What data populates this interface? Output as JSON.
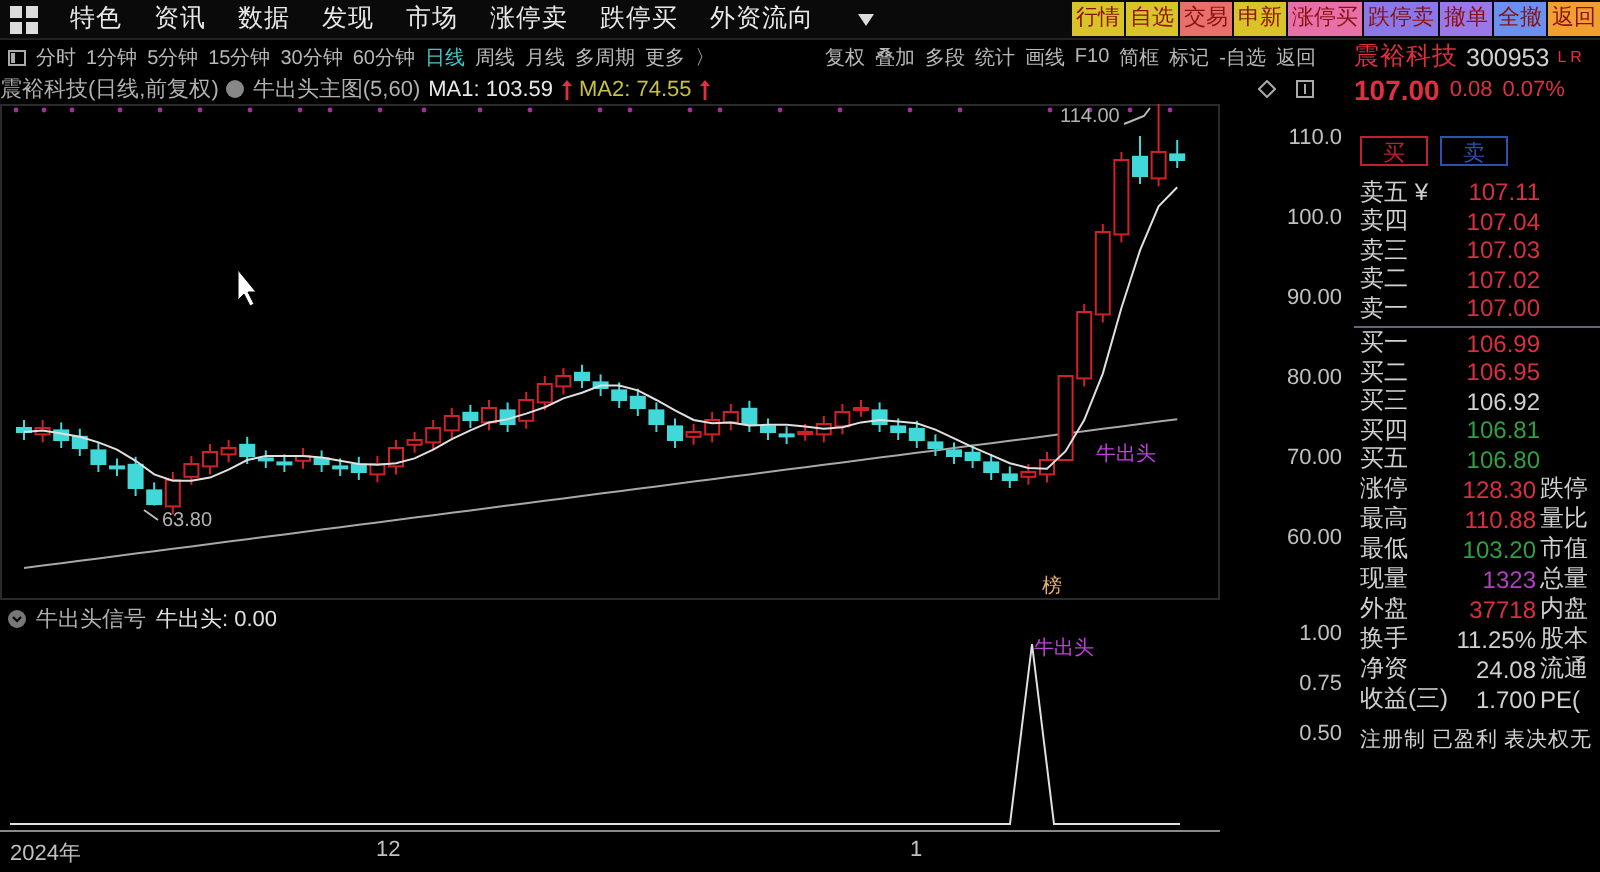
{
  "menu": {
    "items": [
      "特色",
      "资讯",
      "数据",
      "发现",
      "市场",
      "涨停卖",
      "跌停买",
      "外资流向"
    ]
  },
  "quick_buttons": [
    {
      "label": "行情",
      "color": "#d8c428"
    },
    {
      "label": "自选",
      "color": "#d8c428"
    },
    {
      "label": "交易",
      "color": "#e8706a"
    },
    {
      "label": "申新",
      "color": "#d8c428"
    },
    {
      "label": "涨停买",
      "color": "#e870a8"
    },
    {
      "label": "跌停卖",
      "color": "#8a78e8"
    },
    {
      "label": "撤单",
      "color": "#9a78e8"
    },
    {
      "label": "全撤",
      "color": "#6a90f0"
    },
    {
      "label": "返回",
      "color": "#f0a030"
    }
  ],
  "periods": [
    {
      "label": "分时",
      "selected": false
    },
    {
      "label": "1分钟",
      "selected": false
    },
    {
      "label": "5分钟",
      "selected": false
    },
    {
      "label": "15分钟",
      "selected": false
    },
    {
      "label": "30分钟",
      "selected": false
    },
    {
      "label": "60分钟",
      "selected": false
    },
    {
      "label": "日线",
      "selected": true
    },
    {
      "label": "周线",
      "selected": false
    },
    {
      "label": "月线",
      "selected": false
    },
    {
      "label": "多周期",
      "selected": false
    },
    {
      "label": "更多",
      "selected": false
    }
  ],
  "more_arrow": "〉",
  "tools": [
    "复权",
    "叠加",
    "多段",
    "统计",
    "画线",
    "F10",
    "简框",
    "标记",
    "-自选",
    "返回"
  ],
  "legend": {
    "title": "震裕科技(日线,前复权)",
    "indicator": "牛出头主图(5,60)",
    "ma1": "MA1: 103.59",
    "ma2": "MA2: 74.55"
  },
  "chart": {
    "high_label": "114.00",
    "low_label": "63.80",
    "signal_label": "牛出头",
    "rank_badge": "榜",
    "chart_data": {
      "type": "candlestick",
      "ylim": [
        52,
        114
      ],
      "ohlc": [
        [
          73.5,
          74.5,
          72,
          73
        ],
        [
          72.7,
          74.5,
          71.7,
          73.5
        ],
        [
          73.2,
          74.2,
          71,
          72
        ],
        [
          72.4,
          73.4,
          70,
          71
        ],
        [
          70.7,
          71.7,
          68,
          69
        ],
        [
          68.7,
          69.7,
          67.5,
          68.5
        ],
        [
          68.9,
          69.9,
          65,
          66
        ],
        [
          65.7,
          66.7,
          63.8,
          64
        ],
        [
          63.7,
          68,
          62.7,
          67
        ],
        [
          67.4,
          70,
          66.4,
          69
        ],
        [
          68.7,
          71.5,
          67.7,
          70.5
        ],
        [
          70.2,
          72,
          69.2,
          71
        ],
        [
          71.4,
          72.4,
          69,
          70
        ],
        [
          69.7,
          70.7,
          68.5,
          69.5
        ],
        [
          69.2,
          70.2,
          68,
          69
        ],
        [
          69.4,
          71,
          68.4,
          70
        ],
        [
          69.7,
          70.7,
          68,
          69
        ],
        [
          68.7,
          69.7,
          67.5,
          68.5
        ],
        [
          68.9,
          69.9,
          67,
          68
        ],
        [
          67.7,
          70,
          66.7,
          69
        ],
        [
          68.7,
          72,
          67.7,
          71
        ],
        [
          71.4,
          73,
          70.4,
          72
        ],
        [
          71.7,
          74.5,
          70.7,
          73.5
        ],
        [
          73.2,
          76,
          72.2,
          75
        ],
        [
          75.4,
          76.4,
          73.5,
          74.5
        ],
        [
          74.2,
          77,
          73.2,
          76
        ],
        [
          75.7,
          76.7,
          73,
          74
        ],
        [
          74.4,
          78,
          73.4,
          77
        ],
        [
          76.7,
          80,
          75.7,
          79
        ],
        [
          78.7,
          81,
          77.7,
          80
        ],
        [
          80.4,
          81.4,
          78.5,
          79.5
        ],
        [
          79.2,
          80.2,
          77.5,
          78.5
        ],
        [
          78.2,
          79.2,
          76,
          77
        ],
        [
          77.4,
          78.4,
          75,
          76
        ],
        [
          75.7,
          76.7,
          73,
          74
        ],
        [
          73.7,
          74.7,
          71,
          72
        ],
        [
          72.4,
          74,
          71.4,
          73
        ],
        [
          72.7,
          75.5,
          71.7,
          74.5
        ],
        [
          74.2,
          76.5,
          73.2,
          75.5
        ],
        [
          75.9,
          76.9,
          73,
          74
        ],
        [
          73.7,
          74.7,
          72,
          73
        ],
        [
          72.7,
          73.7,
          71.5,
          72.5
        ],
        [
          72.9,
          74,
          71.9,
          73
        ],
        [
          72.7,
          75,
          71.7,
          74
        ],
        [
          73.7,
          76.5,
          72.7,
          75.5
        ],
        [
          75.9,
          77,
          74.9,
          76
        ],
        [
          75.7,
          76.7,
          73,
          74
        ],
        [
          73.7,
          74.7,
          72,
          73
        ],
        [
          73.4,
          74.4,
          71,
          72
        ],
        [
          71.7,
          72.7,
          70,
          71
        ],
        [
          70.7,
          71.7,
          69,
          70
        ],
        [
          70.4,
          71.4,
          68.5,
          69.5
        ],
        [
          69.2,
          70.2,
          67,
          68
        ],
        [
          67.7,
          68.7,
          66,
          67
        ],
        [
          67.4,
          69,
          66.4,
          68
        ],
        [
          67.7,
          70.5,
          66.7,
          69.5
        ],
        [
          69.5,
          80,
          69.5,
          80
        ],
        [
          79.7,
          89,
          78.7,
          88
        ],
        [
          87.7,
          99,
          86.7,
          98
        ],
        [
          97.7,
          108,
          96.7,
          107
        ],
        [
          107.4,
          110,
          104,
          105
        ],
        [
          104.7,
          114,
          103.7,
          108
        ],
        [
          107.7,
          109.5,
          106,
          107
        ]
      ],
      "yticks": [
        {
          "value": 110,
          "label": "110.0"
        },
        {
          "value": 100,
          "label": "100.0"
        },
        {
          "value": 90,
          "label": "90.00"
        },
        {
          "value": 80,
          "label": "80.00"
        },
        {
          "value": 70,
          "label": "70.00"
        },
        {
          "value": 60,
          "label": "60.00"
        }
      ],
      "series": [
        {
          "type": "line",
          "color": "#e0e0e0",
          "values": [
            73,
            73.2,
            72.8,
            72.4,
            71.7,
            70.8,
            69.4,
            67.7,
            66.9,
            66.9,
            67.3,
            68.3,
            69.5,
            70,
            70,
            70,
            69.8,
            69.4,
            69,
            68.9,
            69.1,
            69.7,
            70.8,
            72.1,
            73.2,
            74.2,
            74.6,
            75.3,
            76.1,
            77.2,
            77.9,
            78.8,
            78.8,
            78.2,
            77,
            75.7,
            74.5,
            74.1,
            74.2,
            73.8,
            73.9,
            73.9,
            73.7,
            73.4,
            73.6,
            74.2,
            74.5,
            74.3,
            74.1,
            73.3,
            72.2,
            71.1,
            70.1,
            69.1,
            68.5,
            68.4,
            70.6,
            74.5,
            80.3,
            88.5,
            95.7,
            101.2,
            103.6
          ]
        },
        {
          "type": "line",
          "color": "#a8a8a8",
          "values": [
            56.0,
            56.3,
            56.6,
            56.9,
            57.2,
            57.5,
            57.8,
            58.1,
            58.4,
            58.7,
            59.0,
            59.3,
            59.6,
            59.9,
            60.2,
            60.5,
            60.8,
            61.1,
            61.4,
            61.7,
            62.0,
            62.3,
            62.6,
            62.9,
            63.2,
            63.5,
            63.8,
            64.1,
            64.4,
            64.7,
            65.0,
            65.3,
            65.6,
            65.9,
            66.2,
            66.5,
            66.8,
            67.1,
            67.4,
            67.7,
            68.0,
            68.3,
            68.6,
            68.9,
            69.2,
            69.5,
            69.8,
            70.1,
            70.4,
            70.7,
            71.0,
            71.3,
            71.6,
            71.9,
            72.2,
            72.5,
            72.8,
            73.1,
            73.4,
            73.7,
            74.0,
            74.3,
            74.6
          ]
        }
      ]
    }
  },
  "indicator_panel": {
    "title": "牛出头信号",
    "value": "牛出头: 0.00",
    "y_ticks": [
      "1.00",
      "0.75",
      "0.50"
    ],
    "signal_label": "牛出头"
  },
  "x_axis": [
    "2024年",
    "12",
    "1"
  ],
  "quote": {
    "name": "震裕科技",
    "code": "300953",
    "flags": "L R",
    "price": "107.00",
    "change": "0.08",
    "percent": "0.07%"
  },
  "trade_buttons": [
    {
      "label": "买",
      "color": "#c02030"
    },
    {
      "label": "卖",
      "color": "#3050b0"
    }
  ],
  "order_book": [
    {
      "label": "卖五 ¥",
      "value": "107.11",
      "color": "#d83040"
    },
    {
      "label": "卖四",
      "value": "107.04",
      "color": "#d83040"
    },
    {
      "label": "卖三",
      "value": "107.03",
      "color": "#d83040"
    },
    {
      "label": "卖二",
      "value": "107.02",
      "color": "#d83040"
    },
    {
      "label": "卖一",
      "value": "107.00",
      "color": "#d83040"
    },
    {
      "label": "买一",
      "value": "106.99",
      "color": "#d83040"
    },
    {
      "label": "买二",
      "value": "106.95",
      "color": "#d83040"
    },
    {
      "label": "买三",
      "value": "106.92",
      "color": "#d0d0d0"
    },
    {
      "label": "买四",
      "value": "106.81",
      "color": "#30a040"
    },
    {
      "label": "买五",
      "value": "106.80",
      "color": "#30a040"
    }
  ],
  "stats": [
    {
      "label": "涨停",
      "value": "128.30",
      "color": "#d83040",
      "label2": "跌停"
    },
    {
      "label": "最高",
      "value": "110.88",
      "color": "#d83040",
      "label2": "量比"
    },
    {
      "label": "最低",
      "value": "103.20",
      "color": "#30a040",
      "label2": "市值"
    },
    {
      "label": "现量",
      "value": "1323",
      "color": "#b040c0",
      "label2": "总量"
    },
    {
      "label": "外盘",
      "value": "37718",
      "color": "#d83040",
      "label2": "内盘"
    },
    {
      "label": "换手",
      "value": "11.25%",
      "color": "#d0d0d0",
      "label2": "股本"
    },
    {
      "label": "净资",
      "value": "24.08",
      "color": "#d0d0d0",
      "label2": "流通"
    },
    {
      "label": "收益(三)",
      "value": "1.700",
      "color": "#d0d0d0",
      "label2": "PE("
    }
  ],
  "notes": "注册制 已盈利 表决权无"
}
